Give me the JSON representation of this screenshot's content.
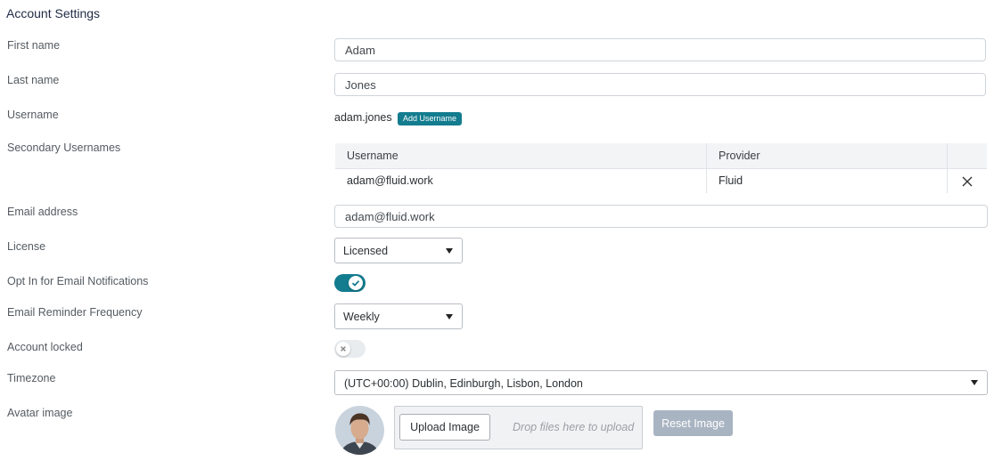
{
  "page": {
    "title": "Account Settings"
  },
  "fields": {
    "first_name": {
      "label": "First name",
      "value": "Adam"
    },
    "last_name": {
      "label": "Last name",
      "value": "Jones"
    },
    "username": {
      "label": "Username",
      "value": "adam.jones",
      "add_label": "Add Username"
    },
    "secondary_usernames": {
      "label": "Secondary Usernames",
      "columns": [
        "Username",
        "Provider"
      ],
      "rows": [
        {
          "username": "adam@fluid.work",
          "provider": "Fluid"
        }
      ]
    },
    "email": {
      "label": "Email address",
      "value": "adam@fluid.work"
    },
    "license": {
      "label": "License",
      "value": "Licensed"
    },
    "email_notifications": {
      "label": "Opt In for Email Notifications",
      "enabled": true
    },
    "reminder_frequency": {
      "label": "Email Reminder Frequency",
      "value": "Weekly"
    },
    "account_locked": {
      "label": "Account locked",
      "enabled": false
    },
    "timezone": {
      "label": "Timezone",
      "value": "(UTC+00:00) Dublin, Edinburgh, Lisbon, London"
    },
    "avatar": {
      "label": "Avatar image",
      "upload_label": "Upload Image",
      "drop_text": "Drop files here to upload",
      "reset_label": "Reset Image"
    }
  },
  "colors": {
    "accent": "#137c8f",
    "reset_button": "#a9b4c2"
  }
}
